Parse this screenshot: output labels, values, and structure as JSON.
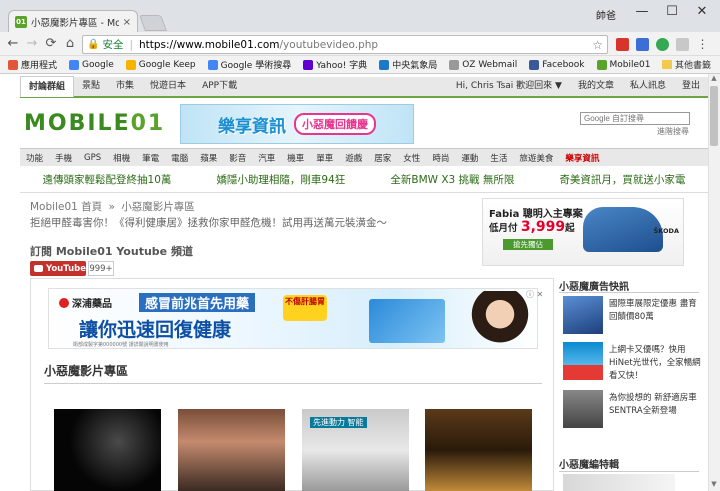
{
  "browser": {
    "tab_title": "小惡魔影片專區 - Mobile",
    "tab_favicon": "01",
    "tab_close": "×",
    "user_label": "帥爸",
    "window_minimize": "—",
    "window_maximize": "☐",
    "window_close": "✕",
    "nav_back": "←",
    "nav_forward": "→",
    "nav_reload": "⟳",
    "nav_home": "⌂",
    "secure_label": "安全",
    "url_host": "https://www.mobile01.com",
    "url_path": "/youtubevideo.php",
    "bookmark_star": "☆",
    "bookmarks": [
      {
        "label": "應用程式",
        "color": "#e0563b"
      },
      {
        "label": "Google",
        "color": "#4285f4"
      },
      {
        "label": "Google Keep",
        "color": "#f6b400"
      },
      {
        "label": "Google 學術搜尋",
        "color": "#4285f4"
      },
      {
        "label": "Yahoo! 字典",
        "color": "#5f01d1"
      },
      {
        "label": "中央氣象局",
        "color": "#1e78c8"
      },
      {
        "label": "OZ Webmail",
        "color": "#999999"
      },
      {
        "label": "Facebook",
        "color": "#3b5998"
      },
      {
        "label": "Mobile01",
        "color": "#5aa32a"
      }
    ],
    "bookmarks_other": "其他書籤"
  },
  "site": {
    "nav_items": [
      "討論群組",
      "景點",
      "市集",
      "悅遊日本",
      "APP下載"
    ],
    "nav_right": [
      "Hi, Chris Tsai 歡迎回來 ▼",
      "我的文章",
      "私人訊息",
      "登出"
    ],
    "logo_text_a": "MOBILE",
    "logo_text_b": "01",
    "banner_big": "樂享資訊",
    "banner_small": "小惡魔回饋慶",
    "search_placeholder": "Google 自訂搜尋",
    "advanced_search": "進階搜尋",
    "categories": [
      "功能",
      "手機",
      "GPS",
      "相機",
      "筆電",
      "電腦",
      "蘋果",
      "影音",
      "汽車",
      "機車",
      "單車",
      "遊戲",
      "居家",
      "女性",
      "時尚",
      "運動",
      "生活",
      "旅遊美食"
    ],
    "category_hot": "樂享資訊",
    "headlines": [
      "遠傳頭家輕鬆配登終抽10萬",
      "嬌隱小助理相隨，剛車94狂",
      "全新BMW X3 挑戰 無所限",
      "奇美資訊月，買就送小家電"
    ],
    "breadcrumb": [
      "Mobile01 首頁",
      "小惡魔影片專區"
    ],
    "breadcrumb_sep": "»",
    "promo": "拒絕甲醛毒害你！《得利健康居》拯救你家甲醛危機！試用再送萬元裝潢金～",
    "section_title": "訂閱 Mobile01 Youtube 頻道",
    "youtube_label": "YouTube",
    "youtube_count": "999+",
    "car_ad": {
      "line1": "Fabia 聰明入主專案",
      "line2_prefix": "低月付",
      "line2_price": "3,999",
      "line2_suffix": "起",
      "button": "搶先獨佔",
      "brand": "ŠKODA"
    },
    "ad_banner": {
      "brand": "深浦藥品",
      "headline_top": "感冒前兆首先用藥",
      "headline_main": "讓你迅速回復健康",
      "tag": "不傷肝腸胃",
      "fine_print": "衛部成製字第000000號 請詳閱說明書使用"
    },
    "ad_close": "ⓘ ✕",
    "video_section_title": "小惡魔影片專區",
    "thumb3_text": "先進動力 智能"
  },
  "sidebar": {
    "title_news": "小惡魔廣告快訊",
    "news": [
      {
        "text": "國際車展限定優惠 盡育回饋價80萬",
        "color": "#2a5aa8"
      },
      {
        "text": "上網卡又優嗎？快用HiNet光世代，全家暢網看又快！",
        "color": "#0a8ad0"
      },
      {
        "text": "為你設想的 新舒適房車 SENTRA全新登場",
        "color": "#555555"
      }
    ],
    "title_features": "小惡魔編特輯"
  }
}
